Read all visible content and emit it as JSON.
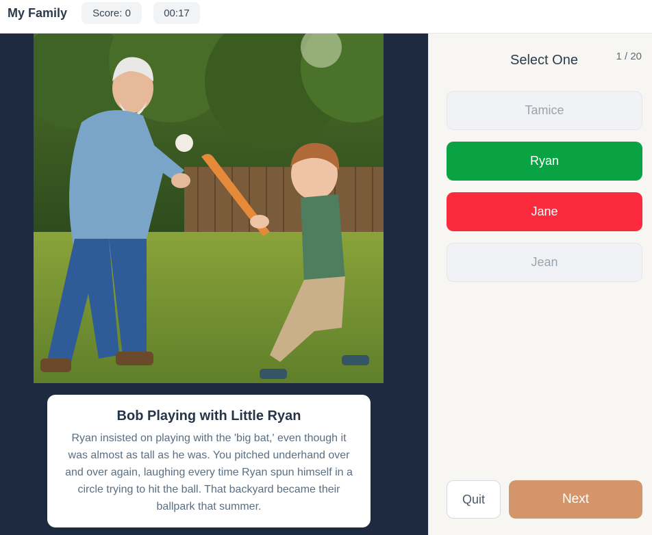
{
  "header": {
    "title": "My Family",
    "score": "Score: 0",
    "timer": "00:17"
  },
  "photo": {
    "caption_title": "Bob Playing with Little Ryan",
    "caption_text": "Ryan insisted on playing with the 'big bat,' even though it was almost as tall as he was. You pitched underhand over and over again, laughing every time Ryan spun himself in a circle trying to hit the ball. That backyard became their ballpark that summer."
  },
  "quiz": {
    "prompt": "Select One",
    "progress": "1 / 20",
    "options": [
      {
        "label": "Tamice",
        "state": "neutral"
      },
      {
        "label": "Ryan",
        "state": "correct"
      },
      {
        "label": "Jane",
        "state": "wrong"
      },
      {
        "label": "Jean",
        "state": "neutral"
      }
    ],
    "quit_label": "Quit",
    "next_label": "Next"
  },
  "colors": {
    "correct": "#0aa344",
    "wrong": "#fb2a3c",
    "next": "#d4956a",
    "left_panel": "#1d2a3f"
  }
}
